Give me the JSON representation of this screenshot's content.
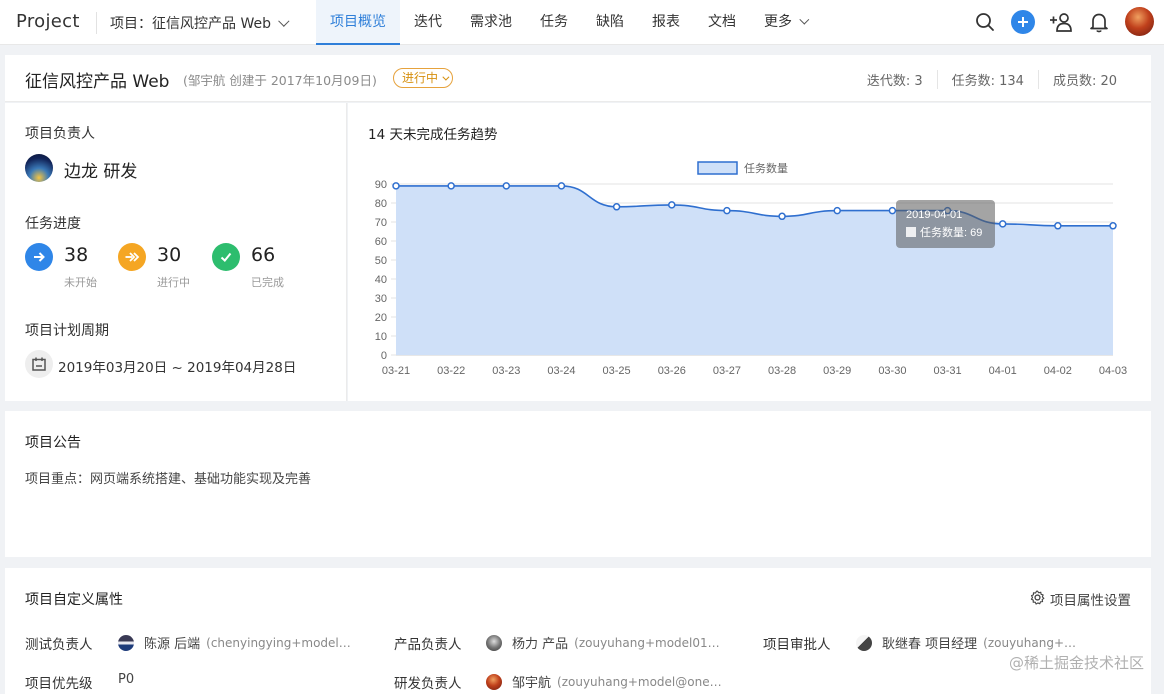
{
  "app": {
    "logo": "Project"
  },
  "nav": {
    "project_selector": "项目：征信风控产品 Web",
    "tabs": [
      {
        "label": "项目概览",
        "active": true
      },
      {
        "label": "迭代"
      },
      {
        "label": "需求池"
      },
      {
        "label": "任务"
      },
      {
        "label": "缺陷"
      },
      {
        "label": "报表"
      },
      {
        "label": "文档"
      },
      {
        "label": "更多"
      }
    ],
    "icons": [
      "search-icon",
      "plus-icon",
      "add-member-icon",
      "bell-icon",
      "user-avatar"
    ]
  },
  "header": {
    "title": "征信风控产品 Web",
    "subtitle": "(邹宇航 创建于 2017年10月09日)",
    "status": "进行中",
    "status_color": "#e6a23c",
    "stats": [
      "迭代数: 3",
      "任务数: 134",
      "成员数: 20"
    ]
  },
  "info": {
    "owner_label": "项目负责人",
    "owner_name": "边龙 研发",
    "progress_label": "任务进度",
    "progress": [
      {
        "value": "38",
        "label": "未开始",
        "color": "#2f86e8",
        "icon": "arrow-right-icon"
      },
      {
        "value": "30",
        "label": "进行中",
        "color": "#f5a623",
        "icon": "double-arrow-icon"
      },
      {
        "value": "66",
        "label": "已完成",
        "color": "#2dbd6e",
        "icon": "check-icon"
      }
    ],
    "period_label": "项目计划周期",
    "period": "2019年03月20日 ~ 2019年04月28日"
  },
  "chart_title": "14 天未完成任务趋势",
  "chart_data": {
    "type": "area",
    "x": [
      "03-21",
      "03-22",
      "03-23",
      "03-24",
      "03-25",
      "03-26",
      "03-27",
      "03-28",
      "03-29",
      "03-30",
      "03-31",
      "04-01",
      "04-02",
      "04-03"
    ],
    "series": [
      {
        "name": "任务数量",
        "values": [
          89,
          89,
          89,
          89,
          78,
          79,
          76,
          73,
          76,
          76,
          76,
          69,
          68,
          68
        ],
        "color": "#2f6fcf",
        "fill": "#cfe0f8"
      }
    ],
    "yticks": [
      0,
      10,
      20,
      30,
      40,
      50,
      60,
      70,
      80,
      90
    ],
    "ylim": [
      0,
      90
    ],
    "grid": true,
    "legend_position": "top-center",
    "tooltip": {
      "title": "2019-04-01",
      "text": "任务数量: 69"
    }
  },
  "announcement": {
    "title": "项目公告",
    "text": "项目重点：网页端系统搭建、基础功能实现及完善"
  },
  "custom_attrs": {
    "title": "项目自定义属性",
    "setting": "项目属性设置",
    "rows": [
      {
        "key": "测试负责人",
        "name": "陈源 后端",
        "email": "(chenyingying+model…"
      },
      {
        "key": "产品负责人",
        "name": "杨力 产品",
        "email": "(zouyuhang+model01…"
      },
      {
        "key": "项目审批人",
        "name": "耿继春 项目经理",
        "email": "(zouyuhang+…"
      },
      {
        "key": "项目优先级",
        "name": "P0",
        "email": ""
      },
      {
        "key": "研发负责人",
        "name": "邹宇航",
        "email": "(zouyuhang+model@one…"
      }
    ]
  },
  "watermark": "@稀土掘金技术社区"
}
